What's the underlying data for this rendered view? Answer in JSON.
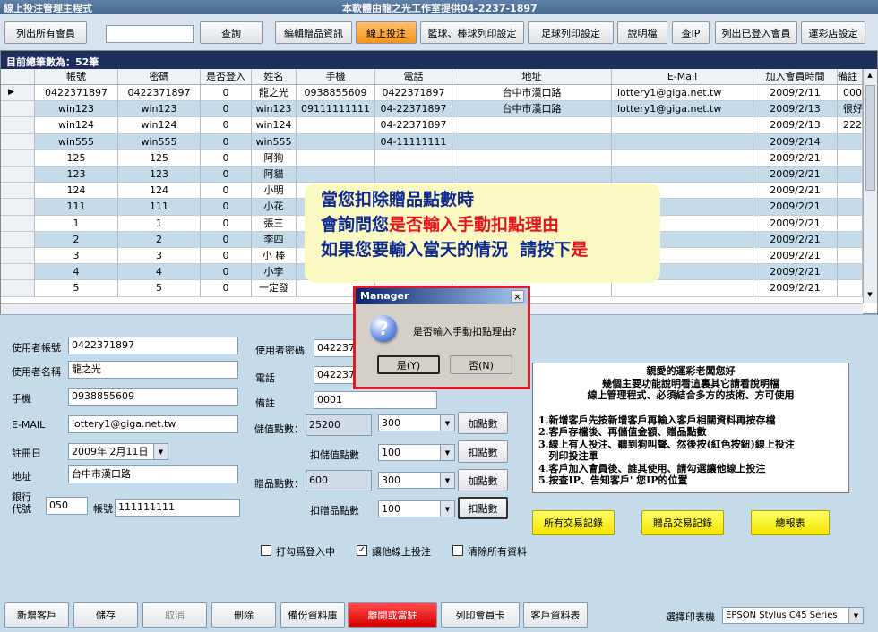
{
  "window": {
    "title": "線上投注管理主程式",
    "center_title": "本軟體由龍之光工作室提供04-2237-1897"
  },
  "toolbar": {
    "list_all": "列出所有會員",
    "search_value": "",
    "query": "查詢",
    "edit_gift": "編輯贈品資訊",
    "online_bet": "線上投注",
    "basketball_print": "籃球、棒球列印設定",
    "football_print": "足球列印設定",
    "manual": "說明檔",
    "check_ip": "查IP",
    "list_logged": "列出已登入會員",
    "lottery_setting": "運彩店設定"
  },
  "grid": {
    "total_label": "目前總筆數為：52筆",
    "columns": [
      "帳號",
      "密碼",
      "是否登入",
      "姓名",
      "手機",
      "電話",
      "地址",
      "E-Mail",
      "加入會員時間",
      "備註"
    ],
    "rows": [
      [
        "0422371897",
        "0422371897",
        "0",
        "龍之光",
        "0938855609",
        "0422371897",
        "台中市漢口路",
        "lottery1@giga.net.tw",
        "2009/2/11",
        "000"
      ],
      [
        "win123",
        "win123",
        "0",
        "win123",
        "09111111111",
        "04-22371897",
        "台中市漢口路",
        "lottery1@giga.net.tw",
        "2009/2/13",
        "很好"
      ],
      [
        "win124",
        "win124",
        "0",
        "win124",
        "",
        "04-22371897",
        "",
        "",
        "2009/2/13",
        "222"
      ],
      [
        "win555",
        "win555",
        "0",
        "win555",
        "",
        "04-11111111",
        "",
        "",
        "2009/2/14",
        ""
      ],
      [
        "125",
        "125",
        "0",
        "阿狗",
        "",
        "",
        "",
        "",
        "2009/2/21",
        ""
      ],
      [
        "123",
        "123",
        "0",
        "阿貓",
        "",
        "",
        "",
        "",
        "2009/2/21",
        ""
      ],
      [
        "124",
        "124",
        "0",
        "小明",
        "",
        "",
        "",
        "",
        "2009/2/21",
        ""
      ],
      [
        "111",
        "111",
        "0",
        "小花",
        "",
        "",
        "",
        "",
        "2009/2/21",
        ""
      ],
      [
        "1",
        "1",
        "0",
        "張三",
        "",
        "",
        "",
        "",
        "2009/2/21",
        ""
      ],
      [
        "2",
        "2",
        "0",
        "李四",
        "",
        "",
        "",
        "",
        "2009/2/21",
        ""
      ],
      [
        "3",
        "3",
        "0",
        "小 棒",
        "",
        "",
        "",
        "",
        "2009/2/21",
        ""
      ],
      [
        "4",
        "4",
        "0",
        "小李",
        "",
        "",
        "",
        "",
        "2009/2/21",
        ""
      ],
      [
        "5",
        "5",
        "0",
        "一定發",
        "",
        "",
        "",
        "",
        "2009/2/21",
        ""
      ]
    ]
  },
  "callout": {
    "l1": "當您扣除贈品點數時",
    "l2a": "會詢問您",
    "l2b": "是否輸入手動扣點理由",
    "l3a": "如果您要輸入當天的情況  請按下",
    "l3b": "是"
  },
  "dialog": {
    "title": "Manager",
    "close": "×",
    "message": "是否輸入手動扣點理由?",
    "yes": "是(Y)",
    "no": "否(N)",
    "icon": "question-icon"
  },
  "form": {
    "account_label": "使用者帳號",
    "account": "0422371897",
    "name_label": "使用者名稱",
    "name": "龍之光",
    "mobile_label": "手機",
    "mobile": "0938855609",
    "email_label": "E-MAIL",
    "email": "lottery1@giga.net.tw",
    "reg_label": "註冊日",
    "reg_date": "2009年  2月11日",
    "addr_label": "地址",
    "addr": "台中市漢口路",
    "bank_label": "銀行代號",
    "bank_code": "050",
    "acct_label": "帳號",
    "acct": "111111111",
    "pwd_label": "使用者密碼",
    "pwd": "0422371",
    "tel_label": "電話",
    "tel": "0422371",
    "remark_label": "備註",
    "remark": "0001",
    "stored_label": "儲值點數：",
    "stored": "25200",
    "stored_amt": "300",
    "add_points": "加點數",
    "deduct_stored_label": "扣儲值點數",
    "deduct_stored_amt": "100",
    "deduct_points": "扣點數",
    "gift_label": "贈品點數：",
    "gift": "600",
    "gift_amt": "300",
    "add_points2": "加點數",
    "deduct_gift_label": "扣贈品點數",
    "deduct_gift_amt": "100",
    "deduct_points2": "扣點數",
    "chk_login": "打勾爲登入中",
    "chk_allow": "讓他線上投注",
    "chk_clear": "清除所有資料",
    "all_trans": "所有交易記錄",
    "gift_trans": "贈品交易記錄",
    "report": "總報表"
  },
  "info": {
    "lines": [
      "親愛的運彩老闆您好",
      "幾個主要功能說明看這裏其它請看說明檔",
      "線上管理程式、必須結合多方的技術、方可使用",
      "1.新增客戶先按新增客戶再輸入客戶相關資料再按存檔",
      "2.客戶存檔後、再儲值金額、贈品點數",
      "3.線上有人投注、聽到狗叫聲、然後按(紅色按鈕)線上投注",
      "   列印投注單",
      "4.客戶加入會員後、誰其使用、請勾選讓他線上投注",
      "5.按查IP、告知客戶' 您IP的位置"
    ]
  },
  "bottom": {
    "new_customer": "新增客戶",
    "save": "儲存",
    "cancel": "取消",
    "delete": "刪除",
    "backup": "備份資料庫",
    "exit": "離開或當駐",
    "print_card": "列印會員卡",
    "customer_data": "客戶資料表",
    "printer_label": "選擇印表機",
    "printer": "EPSON Stylus C45 Series"
  }
}
